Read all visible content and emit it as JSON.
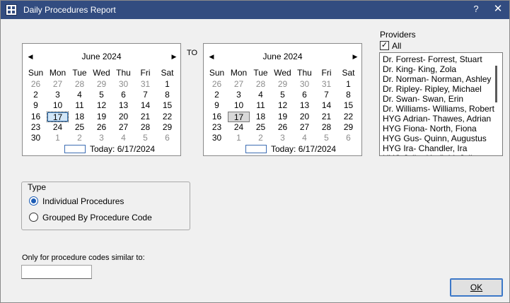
{
  "window": {
    "title": "Daily Procedures Report",
    "help_label": "?",
    "close_label": "✕"
  },
  "calendar_from": {
    "month_label": "June 2024",
    "weekdays": [
      "Sun",
      "Mon",
      "Tue",
      "Wed",
      "Thu",
      "Fri",
      "Sat"
    ],
    "weeks": [
      [
        "26",
        "27",
        "28",
        "29",
        "30",
        "31",
        "1"
      ],
      [
        "2",
        "3",
        "4",
        "5",
        "6",
        "7",
        "8"
      ],
      [
        "9",
        "10",
        "11",
        "12",
        "13",
        "14",
        "15"
      ],
      [
        "16",
        "17",
        "18",
        "19",
        "20",
        "21",
        "22"
      ],
      [
        "23",
        "24",
        "25",
        "26",
        "27",
        "28",
        "29"
      ],
      [
        "30",
        "1",
        "2",
        "3",
        "4",
        "5",
        "6"
      ]
    ],
    "selected_day": "17",
    "today_label": "Today: 6/17/2024"
  },
  "to_label": "TO",
  "calendar_to": {
    "month_label": "June 2024",
    "weekdays": [
      "Sun",
      "Mon",
      "Tue",
      "Wed",
      "Thu",
      "Fri",
      "Sat"
    ],
    "weeks": [
      [
        "26",
        "27",
        "28",
        "29",
        "30",
        "31",
        "1"
      ],
      [
        "2",
        "3",
        "4",
        "5",
        "6",
        "7",
        "8"
      ],
      [
        "9",
        "10",
        "11",
        "12",
        "13",
        "14",
        "15"
      ],
      [
        "16",
        "17",
        "18",
        "19",
        "20",
        "21",
        "22"
      ],
      [
        "23",
        "24",
        "25",
        "26",
        "27",
        "28",
        "29"
      ],
      [
        "30",
        "1",
        "2",
        "3",
        "4",
        "5",
        "6"
      ]
    ],
    "selected_day": "17",
    "today_label": "Today: 6/17/2024"
  },
  "providers": {
    "label": "Providers",
    "all_label": "All",
    "all_checked": true,
    "items": [
      "Dr. Forrest- Forrest, Stuart",
      "Dr. King- King, Zola",
      "Dr. Norman- Norman, Ashley",
      "Dr. Ripley- Ripley, Michael",
      "Dr. Swan- Swan, Erin",
      "Dr. Williams- Williams, Robert",
      "HYG Adrian- Thawes, Adrian",
      "HYG Fiona- North, Fiona",
      "HYG Gus- Quinn, Augustus",
      "HYG Ira- Chandler, Ira",
      "HYG Julie- Hatfield, Julie"
    ]
  },
  "type_group": {
    "title": "Type",
    "options": [
      "Individual Procedures",
      "Grouped By Procedure Code"
    ],
    "selected": "Individual Procedures"
  },
  "codes": {
    "label": "Only for procedure codes similar to:",
    "value": ""
  },
  "ok_label": "OK"
}
